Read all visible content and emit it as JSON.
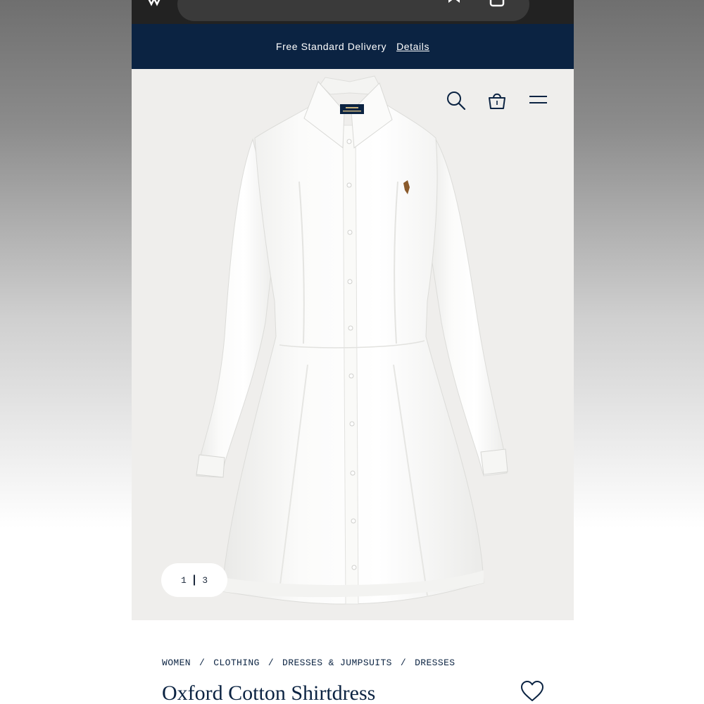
{
  "promo": {
    "text": "Free Standard Delivery",
    "link_label": "Details"
  },
  "header": {
    "icons": [
      "search-icon",
      "shopping-bag-icon",
      "menu-icon"
    ]
  },
  "gallery": {
    "current": "1",
    "total": "3"
  },
  "breadcrumb": [
    "WOMEN",
    "CLOTHING",
    "DRESSES & JUMPSUITS",
    "DRESSES"
  ],
  "product": {
    "title": "Oxford Cotton Shirtdress"
  },
  "colors": {
    "navy": "#0b2342",
    "hero_bg": "#efeeec",
    "browser_bar": "#222222"
  }
}
